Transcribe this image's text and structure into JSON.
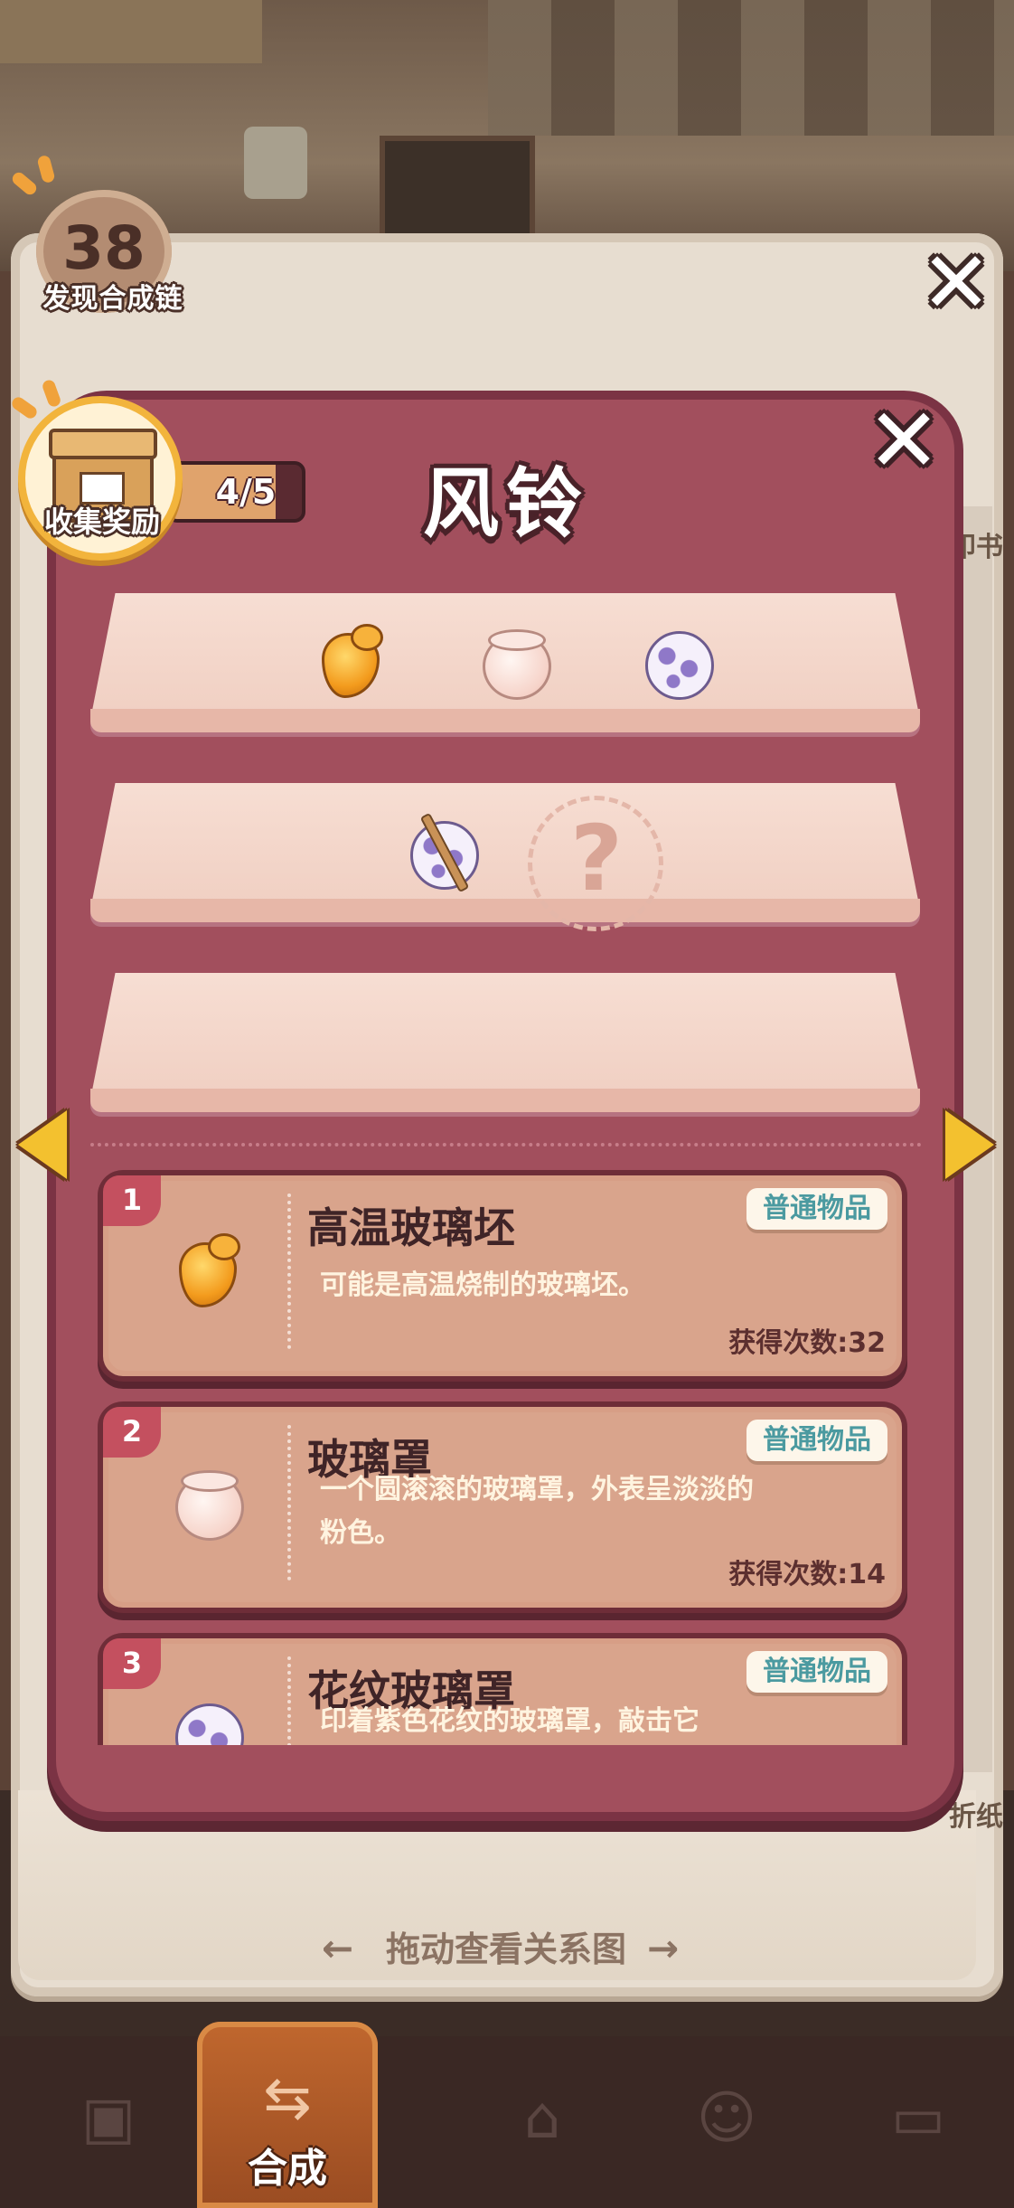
{
  "counter": {
    "value": "38",
    "label": "发现合成链"
  },
  "reward": {
    "label": "收集奖励",
    "progress_text": "4/5",
    "progress": 0.8
  },
  "dialog": {
    "title": "风铃"
  },
  "item_cards": [
    {
      "index": "1",
      "name": "高温玻璃坯",
      "rarity": "普通物品",
      "description": "可能是高温烧制的玻璃坯。",
      "count_label": "获得次数:",
      "count": "32",
      "icon": "orange-glass-blob-icon"
    },
    {
      "index": "2",
      "name": "玻璃罩",
      "rarity": "普通物品",
      "description": "一个圆滚滚的玻璃罩，外表呈淡淡的粉色。",
      "count_label": "获得次数:",
      "count": "14",
      "icon": "pink-glass-jar-icon"
    },
    {
      "index": "3",
      "name": "花纹玻璃罩",
      "rarity": "普通物品",
      "description": "印着紫色花纹的玻璃罩，敲击它",
      "count_label": "",
      "count": "",
      "icon": "floral-glass-jar-icon"
    }
  ],
  "unknown_slot": "?",
  "drag_hint": "拖动查看关系图",
  "side_labels": {
    "a": "印书",
    "b": "折纸"
  },
  "bottom_nav": [
    {
      "icon": "backpack-icon",
      "label": ""
    },
    {
      "icon": "merge-icon",
      "label": "合成",
      "active": true
    },
    {
      "icon": "service-bell-icon",
      "label": ""
    },
    {
      "icon": "worker-icon",
      "label": ""
    },
    {
      "icon": "bus-icon",
      "label": ""
    }
  ],
  "colors": {
    "dialog": "#a24f5d",
    "shelf": "#f7ded3",
    "card": "#d9a48c",
    "rarity_text": "#4b9aa0",
    "accent": "#f3c12f"
  }
}
